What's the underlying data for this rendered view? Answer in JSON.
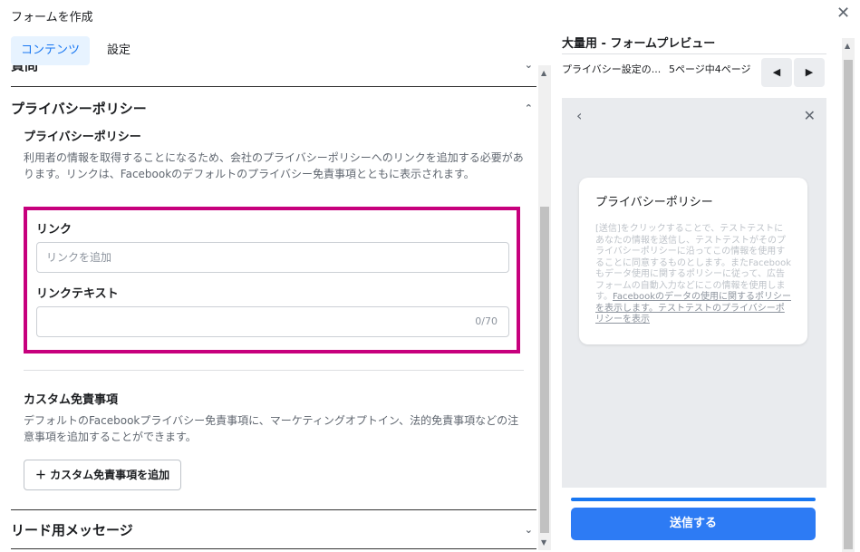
{
  "title": "フォームを作成",
  "tabs": [
    "コンテンツ",
    "設定"
  ],
  "left": {
    "questions": "質問",
    "privacy_section": "プライバシーポリシー",
    "privacy_subtitle": "プライバシーポリシー",
    "privacy_desc": "利用者の情報を取得することになるため、会社のプライバシーポリシーへのリンクを追加する必要があります。リンクは、Facebookのデフォルトのプライバシー免責事項とともに表示されます。",
    "link_label": "リンク",
    "link_placeholder": "リンクを追加",
    "linktext_label": "リンクテキスト",
    "linktext_counter": "0/70",
    "custom_title": "カスタム免責事項",
    "custom_desc": "デフォルトのFacebookプライバシー免責事項に、マーケティングオプトイン、法的免責事項などの注意事項を追加することができます。",
    "add_custom_button": "＋ カスタム免責事項を追加",
    "lead_section": "リード用メッセージ"
  },
  "preview": {
    "title": "大量用 - フォームプレビュー",
    "selector": "プライバシー設定の...",
    "page_info": "5ページ中4ページ",
    "card_title": "プライバシーポリシー",
    "card_text": "[送信]をクリックすることで、テストテストにあなたの情報を送信し、テストテストがそのプライバシーポリシーに沿ってこの情報を使用することに同意するものとします。またFacebookもデータ使用に関するポリシーに従って、広告フォームの自動入力などにこの情報を使用します。",
    "card_link": "Facebookのデータの使用に関するポリシーを表示します。テストテストのプライバシーポリシーを表示",
    "submit_button": "送信する"
  },
  "colors": {
    "accent": "#1877f2",
    "highlight": "#c7007d",
    "submit": "#2d7bf4"
  }
}
